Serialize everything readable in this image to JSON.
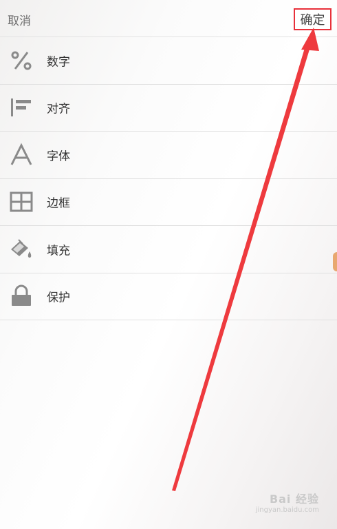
{
  "header": {
    "cancel_label": "取消",
    "confirm_label": "确定"
  },
  "menu": {
    "items": [
      {
        "label": "数字",
        "icon": "percent-icon"
      },
      {
        "label": "对齐",
        "icon": "align-left-icon"
      },
      {
        "label": "字体",
        "icon": "font-icon"
      },
      {
        "label": "边框",
        "icon": "border-grid-icon"
      },
      {
        "label": "填充",
        "icon": "fill-bucket-icon"
      },
      {
        "label": "保护",
        "icon": "lock-icon"
      }
    ]
  },
  "colors": {
    "highlight": "#e8303a",
    "icon": "#8a8a8a",
    "divider": "#e0e0e0"
  },
  "watermark": {
    "main": "Bai 经验",
    "sub": "jingyan.baidu.com"
  }
}
